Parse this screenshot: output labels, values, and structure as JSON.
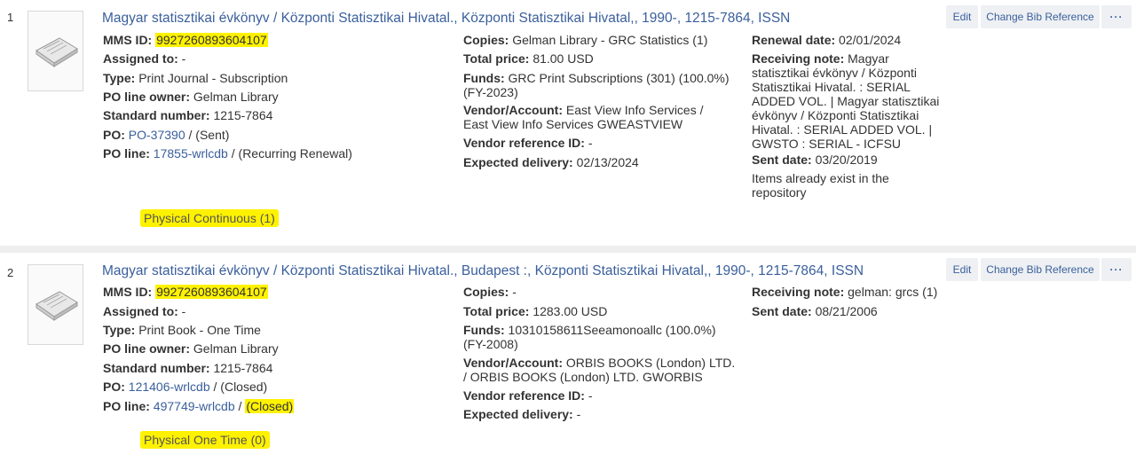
{
  "results": [
    {
      "number": "1",
      "title": "Magyar statisztikai évkönyv / Központi Statisztikai Hivatal., Központi Statisztikai Hivatal,, 1990-, 1215-7864, ISSN",
      "mms_label": "MMS ID:",
      "mms_value": "9927260893604107",
      "assigned_label": "Assigned to:",
      "assigned_value": "-",
      "type_label": "Type:",
      "type_value": "Print Journal - Subscription",
      "owner_label": "PO line owner:",
      "owner_value": "Gelman Library",
      "std_label": "Standard number:",
      "std_value": "1215-7864",
      "po_label": "PO:",
      "po_link": "PO-37390",
      "po_status": "/ (Sent)",
      "poline_label": "PO line:",
      "poline_link": "17855-wrlcdb",
      "poline_sep": "/",
      "poline_status": "(Recurring Renewal)",
      "copies_label": "Copies:",
      "copies_value": "Gelman Library - GRC Statistics (1)",
      "price_label": "Total price:",
      "price_value": "81.00 USD",
      "funds_label": "Funds:",
      "funds_line1": "GRC Print Subscriptions (301) (100.0%)",
      "funds_line2": "(FY-2023)",
      "vendor_label": "Vendor/Account:",
      "vendor_line1": "East View Info Services /",
      "vendor_line2": "East View Info Services GWEASTVIEW",
      "vref_label": "Vendor reference ID:",
      "vref_value": "-",
      "exp_label": "Expected delivery:",
      "exp_value": "02/13/2024",
      "renewal_label": "Renewal date:",
      "renewal_value": "02/01/2024",
      "recv_label": "Receiving note:",
      "recv_lines": [
        "Magyar",
        "statisztikai évkönyv / Központi",
        "Statisztikai Hivatal. : SERIAL",
        "ADDED VOL. | Magyar statisztikai",
        "évkönyv / Központi Statisztikai",
        "Hivatal. : SERIAL ADDED VOL. |",
        "GWSTO : SERIAL - ICFSU"
      ],
      "sent_label": "Sent date:",
      "sent_value": "03/20/2019",
      "items_line1": "Items already exist in the",
      "items_line2": "repository",
      "physical": "Physical Continuous (1)",
      "btn_edit": "Edit",
      "btn_change": "Change Bib Reference",
      "btn_more": "···"
    },
    {
      "number": "2",
      "title": "Magyar statisztikai évkönyv / Központi Statisztikai Hivatal., Budapest :, Központi Statisztikai Hivatal,, 1990-, 1215-7864, ISSN",
      "mms_label": "MMS ID:",
      "mms_value": "9927260893604107",
      "assigned_label": "Assigned to:",
      "assigned_value": "-",
      "type_label": "Type:",
      "type_value": "Print Book - One Time",
      "owner_label": "PO line owner:",
      "owner_value": "Gelman Library",
      "std_label": "Standard number:",
      "std_value": "1215-7864",
      "po_label": "PO:",
      "po_link": "121406-wrlcdb",
      "po_status": "/ (Closed)",
      "poline_label": "PO line:",
      "poline_link": "497749-wrlcdb",
      "poline_sep": "/",
      "poline_status": "(Closed)",
      "copies_label": "Copies:",
      "copies_value": "-",
      "price_label": "Total price:",
      "price_value": "1283.00 USD",
      "funds_label": "Funds:",
      "funds_line1": "10310158611Seeamonoallc (100.0%)",
      "funds_line2": "(FY-2008)",
      "vendor_label": "Vendor/Account:",
      "vendor_line1": "ORBIS BOOKS (London) LTD.",
      "vendor_line2": "/ ORBIS BOOKS (London) LTD. GWORBIS",
      "vref_label": "Vendor reference ID:",
      "vref_value": "-",
      "exp_label": "Expected delivery:",
      "exp_value": "-",
      "recv_label": "Receiving note:",
      "recv_value": "gelman: grcs (1)",
      "sent_label": "Sent date:",
      "sent_value": "08/21/2006",
      "physical": "Physical One Time (0)",
      "btn_edit": "Edit",
      "btn_change": "Change Bib Reference",
      "btn_more": "···"
    }
  ]
}
